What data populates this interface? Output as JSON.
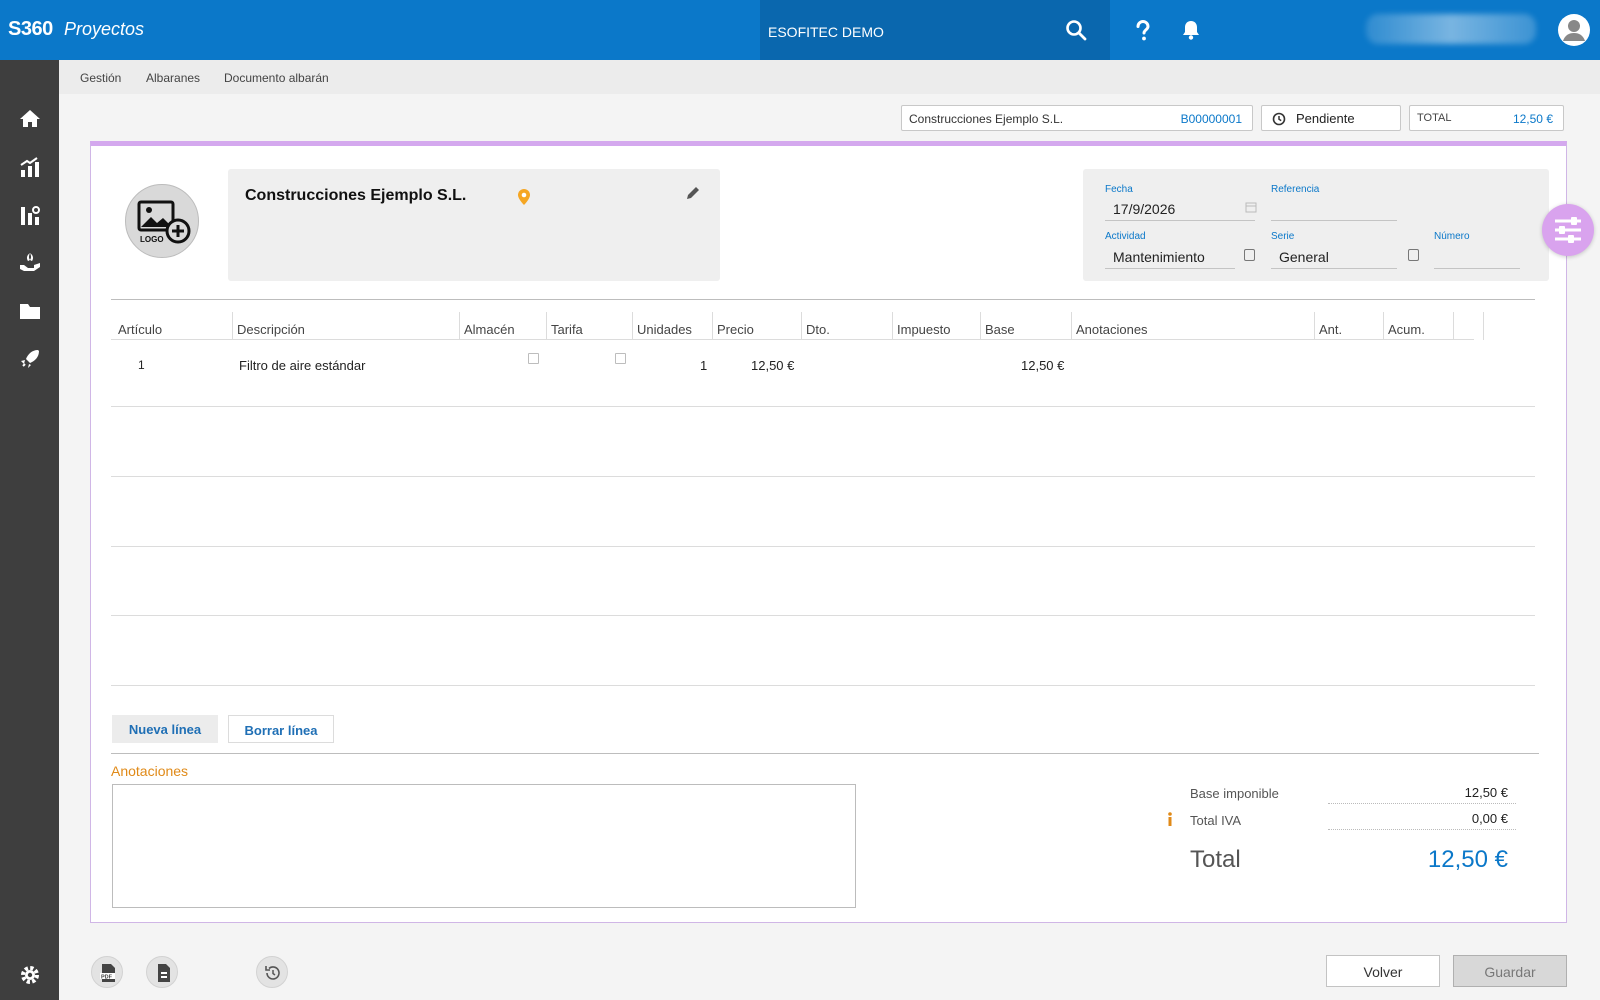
{
  "app": {
    "brand": "S360",
    "module": "Proyectos",
    "company": "ESOFITEC DEMO"
  },
  "breadcrumb": [
    "Gestión",
    "Albaranes",
    "Documento albarán"
  ],
  "header": {
    "client": "Construcciones Ejemplo S.L.",
    "doc_number": "B00000001",
    "status": "Pendiente",
    "total_label": "TOTAL",
    "total_value": "12,50 €"
  },
  "client_card": {
    "name": "Construcciones Ejemplo S.L.",
    "logo_text": "LOGO"
  },
  "meta": {
    "fecha_label": "Fecha",
    "fecha": "17/9/2026",
    "referencia_label": "Referencia",
    "referencia": "",
    "actividad_label": "Actividad",
    "actividad": "Mantenimiento",
    "serie_label": "Serie",
    "serie": "General",
    "numero_label": "Número",
    "numero": ""
  },
  "table": {
    "columns": [
      "Artículo",
      "Descripción",
      "Almacén",
      "Tarifa",
      "Unidades",
      "Precio",
      "Dto.",
      "Impuesto",
      "Base",
      "Anotaciones",
      "Ant.",
      "Acum."
    ],
    "rows": [
      {
        "articulo": "1",
        "descripcion": "Filtro de aire estándar",
        "unidades": "1",
        "precio": "12,50 €",
        "base": "12,50 €"
      }
    ]
  },
  "buttons": {
    "nueva_linea": "Nueva línea",
    "borrar_linea": "Borrar línea",
    "volver": "Volver",
    "guardar": "Guardar"
  },
  "annotations": {
    "title": "Anotaciones",
    "value": ""
  },
  "summary": {
    "base_label": "Base imponible",
    "base_value": "12,50 €",
    "iva_label": "Total IVA",
    "iva_value": "0,00 €",
    "total_label": "Total",
    "total_value": "12,50 €"
  },
  "colors": {
    "primary": "#0b78c9",
    "sidebar": "#3e3e3e",
    "accent_purple": "#d9a3ee",
    "orange": "#e08a18"
  }
}
